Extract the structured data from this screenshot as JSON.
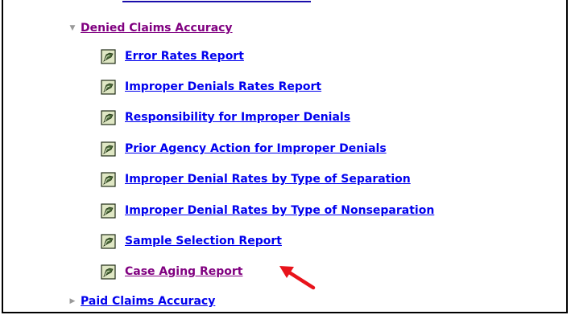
{
  "tree": {
    "denied_group": {
      "toggle_icon": "triangle-down-icon",
      "label": "Denied Claims Accuracy",
      "visited": true,
      "items": [
        {
          "label": "Error Rates Report",
          "icon": "report-icon",
          "visited": false
        },
        {
          "label": "Improper Denials Rates Report",
          "icon": "report-icon",
          "visited": false
        },
        {
          "label": "Responsibility for Improper Denials",
          "icon": "report-icon",
          "visited": false
        },
        {
          "label": "Prior Agency Action for Improper Denials",
          "icon": "report-icon",
          "visited": false
        },
        {
          "label": "Improper Denial Rates by Type of Separation",
          "icon": "report-icon",
          "visited": false
        },
        {
          "label": "Improper Denial Rates by Type of Nonseparation",
          "icon": "report-icon",
          "visited": false
        },
        {
          "label": "Sample Selection Report",
          "icon": "report-icon",
          "visited": false
        },
        {
          "label": "Case Aging Report",
          "icon": "report-icon",
          "visited": true
        }
      ]
    },
    "paid_group": {
      "toggle_icon": "triangle-right-icon",
      "label": "Paid Claims Accuracy",
      "visited": false
    }
  },
  "annotation": {
    "arrow_icon": "red-arrow-icon",
    "color": "#e8131b"
  },
  "colors": {
    "link": "#0000ee",
    "visited_link": "#800080",
    "border": "#000000",
    "background": "#ffffff"
  }
}
